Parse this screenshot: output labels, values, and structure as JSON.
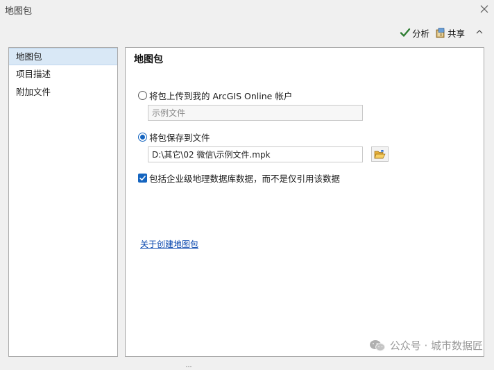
{
  "window": {
    "title": "地图包"
  },
  "toolbar": {
    "analyze_label": "分析",
    "share_label": "共享"
  },
  "sidebar": {
    "items": [
      {
        "label": "地图包",
        "active": true
      },
      {
        "label": "项目描述",
        "active": false
      },
      {
        "label": "附加文件",
        "active": false
      }
    ]
  },
  "panel": {
    "title": "地图包",
    "upload_option_label": "将包上传到我的 ArcGIS Online 帐户",
    "upload_name_placeholder": "示例文件",
    "save_option_label": "将包保存到文件",
    "save_path_value": "D:\\其它\\02 微信\\示例文件.mpk",
    "include_enterprise_label": "包括企业级地理数据库数据，而不是仅引用该数据",
    "help_link_label": "关于创建地图包"
  },
  "watermark": {
    "text": "公众号 · 城市数据匠"
  },
  "colors": {
    "accent": "#1565c0",
    "link": "#0645ad",
    "nav_active": "#d9e8f6"
  },
  "icons": {
    "analyze": "checkmark-icon",
    "share": "share-package-icon",
    "collapse": "chevron-up-icon",
    "browse": "folder-open-icon",
    "close": "close-icon"
  }
}
